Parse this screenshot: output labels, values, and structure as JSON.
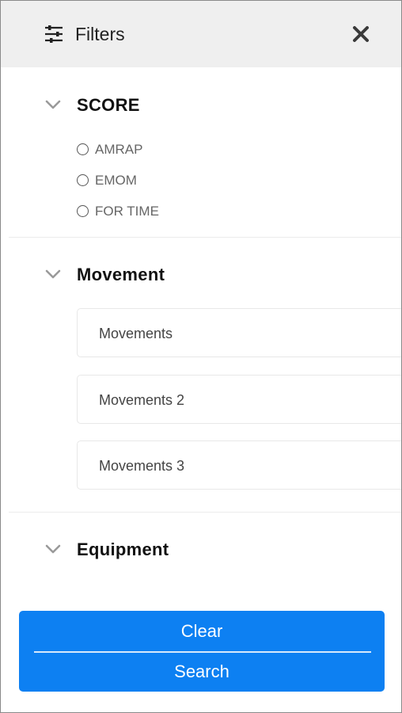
{
  "header": {
    "title": "Filters",
    "filter_icon": "sliders-icon",
    "close_icon": "close-icon"
  },
  "sections": {
    "score": {
      "title": "SCORE",
      "expanded": true,
      "options": [
        {
          "label": "AMRAP",
          "selected": false
        },
        {
          "label": "EMOM",
          "selected": false
        },
        {
          "label": "FOR TIME",
          "selected": false
        }
      ]
    },
    "movement": {
      "title": "Movement",
      "expanded": true,
      "fields": [
        {
          "value": "Movements"
        },
        {
          "value": "Movements 2"
        },
        {
          "value": "Movements 3"
        }
      ]
    },
    "equipment": {
      "title": "Equipment",
      "expanded": false
    }
  },
  "actions": {
    "clear_label": "Clear",
    "search_label": "Search"
  },
  "colors": {
    "header_bg": "#efefef",
    "button_bg": "#0d80f2",
    "button_text": "#ffffff",
    "chevron": "#9a9a9a"
  }
}
